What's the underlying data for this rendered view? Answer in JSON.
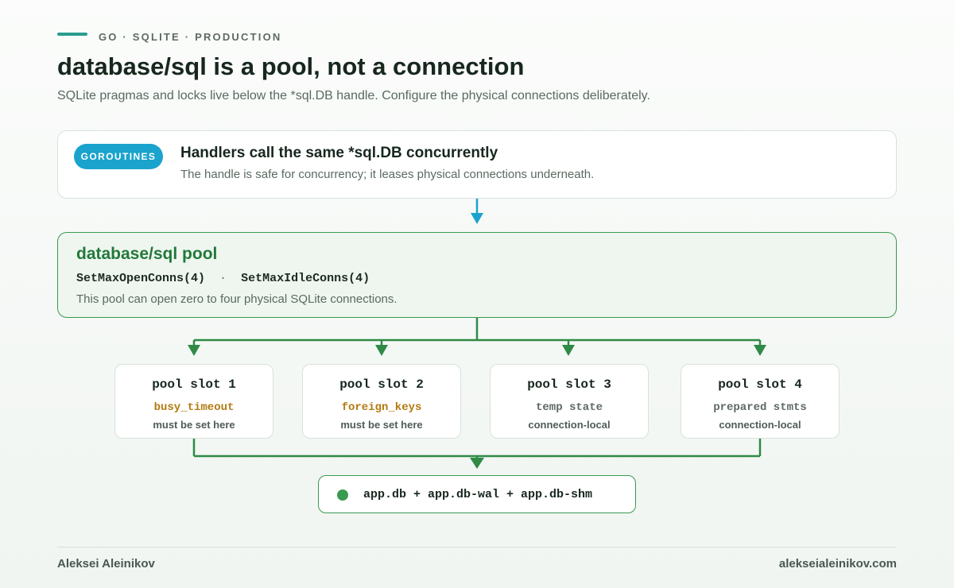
{
  "eyebrow": "GO · SQLITE · PRODUCTION",
  "title": "database/sql is a pool, not a connection",
  "subtitle": "SQLite pragmas and locks live below the *sql.DB handle. Configure the physical connections deliberately.",
  "goroutines": {
    "badge": "GOROUTINES",
    "heading": "Handlers call the same *sql.DB concurrently",
    "description": "The handle is safe for concurrency; it leases physical connections underneath."
  },
  "pool": {
    "heading": "database/sql pool",
    "setting_open": "SetMaxOpenConns(4)",
    "separator": "·",
    "setting_idle": "SetMaxIdleConns(4)",
    "description": "This pool can open zero to four physical SQLite connections."
  },
  "slots": [
    {
      "title": "pool slot 1",
      "key": "busy_timeout",
      "note": "must be set here"
    },
    {
      "title": "pool slot 2",
      "key": "foreign_keys",
      "note": "must be set here"
    },
    {
      "title": "pool slot 3",
      "key": "temp state",
      "note": "connection-local"
    },
    {
      "title": "pool slot 4",
      "key": "prepared stmts",
      "note": "connection-local"
    }
  ],
  "database_files": "app.db + app.db-wal + app.db-shm",
  "footer": {
    "author": "Aleksei Aleinikov",
    "site": "alekseialeinikov.com"
  },
  "colors": {
    "accent_teal": "#2a9d8f",
    "badge_blue": "#1aa3cc",
    "pool_green": "#3a9a4f",
    "warn_amber": "#b37b12"
  }
}
